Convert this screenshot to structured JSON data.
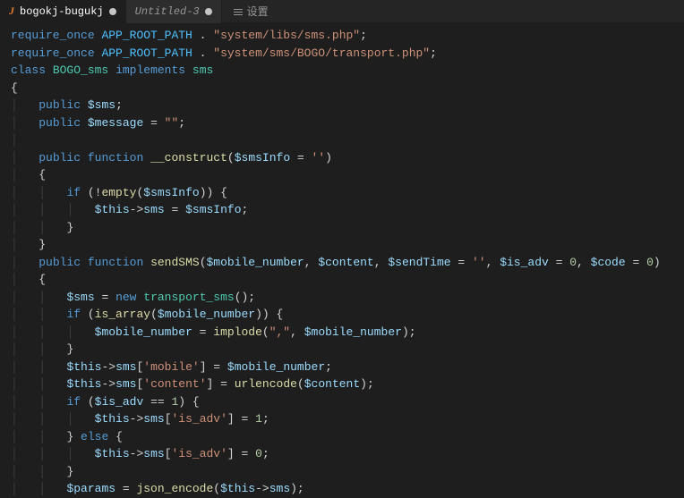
{
  "tabs": [
    {
      "icon": "J",
      "label": "bogokj-bugukj",
      "modified": true
    },
    {
      "label": "Untitled-3",
      "modified": true
    }
  ],
  "menu": {
    "settings_label": "设置"
  },
  "code": {
    "lines": [
      [
        [
          "kw",
          "require_once"
        ],
        [
          "punc",
          " "
        ],
        [
          "const",
          "APP_ROOT_PATH"
        ],
        [
          "punc",
          " . "
        ],
        [
          "str",
          "\"system/libs/sms.php\""
        ],
        [
          "punc",
          ";"
        ]
      ],
      [
        [
          "kw",
          "require_once"
        ],
        [
          "punc",
          " "
        ],
        [
          "const",
          "APP_ROOT_PATH"
        ],
        [
          "punc",
          " . "
        ],
        [
          "str",
          "\"system/sms/BOGO/transport.php\""
        ],
        [
          "punc",
          ";"
        ]
      ],
      [
        [
          "kw",
          "class"
        ],
        [
          "punc",
          " "
        ],
        [
          "cls",
          "BOGO_sms"
        ],
        [
          "punc",
          " "
        ],
        [
          "kw",
          "implements"
        ],
        [
          "punc",
          " "
        ],
        [
          "cls",
          "sms"
        ]
      ],
      [
        [
          "brace",
          "{"
        ]
      ],
      [
        [
          "pad",
          "  "
        ],
        [
          "kw",
          "public"
        ],
        [
          "punc",
          " "
        ],
        [
          "var",
          "$sms"
        ],
        [
          "punc",
          ";"
        ]
      ],
      [
        [
          "pad",
          "  "
        ],
        [
          "kw",
          "public"
        ],
        [
          "punc",
          " "
        ],
        [
          "var",
          "$message"
        ],
        [
          "punc",
          " = "
        ],
        [
          "str",
          "\"\""
        ],
        [
          "punc",
          ";"
        ]
      ],
      [
        [
          "pad",
          " "
        ]
      ],
      [
        [
          "pad",
          "  "
        ],
        [
          "kw",
          "public"
        ],
        [
          "punc",
          " "
        ],
        [
          "kw",
          "function"
        ],
        [
          "punc",
          " "
        ],
        [
          "fn",
          "__construct"
        ],
        [
          "punc",
          "("
        ],
        [
          "var",
          "$smsInfo"
        ],
        [
          "punc",
          " = "
        ],
        [
          "str",
          "''"
        ],
        [
          "punc",
          ")"
        ]
      ],
      [
        [
          "pad",
          "  "
        ],
        [
          "brace",
          "{"
        ]
      ],
      [
        [
          "pad",
          "    "
        ],
        [
          "kw",
          "if"
        ],
        [
          "punc",
          " (!"
        ],
        [
          "fn",
          "empty"
        ],
        [
          "punc",
          "("
        ],
        [
          "var",
          "$smsInfo"
        ],
        [
          "punc",
          ")) {"
        ]
      ],
      [
        [
          "pad",
          "      "
        ],
        [
          "var",
          "$this"
        ],
        [
          "punc",
          "->"
        ],
        [
          "var",
          "sms"
        ],
        [
          "punc",
          " = "
        ],
        [
          "var",
          "$smsInfo"
        ],
        [
          "punc",
          ";"
        ]
      ],
      [
        [
          "pad",
          "    "
        ],
        [
          "brace",
          "}"
        ]
      ],
      [
        [
          "pad",
          "  "
        ],
        [
          "brace",
          "}"
        ]
      ],
      [
        [
          "pad",
          "  "
        ],
        [
          "kw",
          "public"
        ],
        [
          "punc",
          " "
        ],
        [
          "kw",
          "function"
        ],
        [
          "punc",
          " "
        ],
        [
          "fn",
          "sendSMS"
        ],
        [
          "punc",
          "("
        ],
        [
          "var",
          "$mobile_number"
        ],
        [
          "punc",
          ", "
        ],
        [
          "var",
          "$content"
        ],
        [
          "punc",
          ", "
        ],
        [
          "var",
          "$sendTime"
        ],
        [
          "punc",
          " = "
        ],
        [
          "str",
          "''"
        ],
        [
          "punc",
          ", "
        ],
        [
          "var",
          "$is_adv"
        ],
        [
          "punc",
          " = "
        ],
        [
          "num",
          "0"
        ],
        [
          "punc",
          ", "
        ],
        [
          "var",
          "$code"
        ],
        [
          "punc",
          " = "
        ],
        [
          "num",
          "0"
        ],
        [
          "punc",
          ")"
        ]
      ],
      [
        [
          "pad",
          "  "
        ],
        [
          "brace",
          "{"
        ]
      ],
      [
        [
          "pad",
          "    "
        ],
        [
          "var",
          "$sms"
        ],
        [
          "punc",
          " = "
        ],
        [
          "kw",
          "new"
        ],
        [
          "punc",
          " "
        ],
        [
          "cls",
          "transport_sms"
        ],
        [
          "punc",
          "();"
        ]
      ],
      [
        [
          "pad",
          "    "
        ],
        [
          "kw",
          "if"
        ],
        [
          "punc",
          " ("
        ],
        [
          "fn",
          "is_array"
        ],
        [
          "punc",
          "("
        ],
        [
          "var",
          "$mobile_number"
        ],
        [
          "punc",
          ")) {"
        ]
      ],
      [
        [
          "pad",
          "      "
        ],
        [
          "var",
          "$mobile_number"
        ],
        [
          "punc",
          " = "
        ],
        [
          "fn",
          "implode"
        ],
        [
          "punc",
          "("
        ],
        [
          "str",
          "\",\""
        ],
        [
          "punc",
          ", "
        ],
        [
          "var",
          "$mobile_number"
        ],
        [
          "punc",
          ");"
        ]
      ],
      [
        [
          "pad",
          "    "
        ],
        [
          "brace",
          "}"
        ]
      ],
      [
        [
          "pad",
          "    "
        ],
        [
          "var",
          "$this"
        ],
        [
          "punc",
          "->"
        ],
        [
          "var",
          "sms"
        ],
        [
          "punc",
          "["
        ],
        [
          "str",
          "'mobile'"
        ],
        [
          "punc",
          "] = "
        ],
        [
          "var",
          "$mobile_number"
        ],
        [
          "punc",
          ";"
        ]
      ],
      [
        [
          "pad",
          "    "
        ],
        [
          "var",
          "$this"
        ],
        [
          "punc",
          "->"
        ],
        [
          "var",
          "sms"
        ],
        [
          "punc",
          "["
        ],
        [
          "str",
          "'content'"
        ],
        [
          "punc",
          "] = "
        ],
        [
          "fn",
          "urlencode"
        ],
        [
          "punc",
          "("
        ],
        [
          "var",
          "$content"
        ],
        [
          "punc",
          ");"
        ]
      ],
      [
        [
          "pad",
          "    "
        ],
        [
          "kw",
          "if"
        ],
        [
          "punc",
          " ("
        ],
        [
          "var",
          "$is_adv"
        ],
        [
          "punc",
          " == "
        ],
        [
          "num",
          "1"
        ],
        [
          "punc",
          ") {"
        ]
      ],
      [
        [
          "pad",
          "      "
        ],
        [
          "var",
          "$this"
        ],
        [
          "punc",
          "->"
        ],
        [
          "var",
          "sms"
        ],
        [
          "punc",
          "["
        ],
        [
          "str",
          "'is_adv'"
        ],
        [
          "punc",
          "] = "
        ],
        [
          "num",
          "1"
        ],
        [
          "punc",
          ";"
        ]
      ],
      [
        [
          "pad",
          "    "
        ],
        [
          "punc",
          "} "
        ],
        [
          "kw",
          "else"
        ],
        [
          "punc",
          " {"
        ]
      ],
      [
        [
          "pad",
          "      "
        ],
        [
          "var",
          "$this"
        ],
        [
          "punc",
          "->"
        ],
        [
          "var",
          "sms"
        ],
        [
          "punc",
          "["
        ],
        [
          "str",
          "'is_adv'"
        ],
        [
          "punc",
          "] = "
        ],
        [
          "num",
          "0"
        ],
        [
          "punc",
          ";"
        ]
      ],
      [
        [
          "pad",
          "    "
        ],
        [
          "brace",
          "}"
        ]
      ],
      [
        [
          "pad",
          "    "
        ],
        [
          "var",
          "$params"
        ],
        [
          "punc",
          " = "
        ],
        [
          "fn",
          "json_encode"
        ],
        [
          "punc",
          "("
        ],
        [
          "var",
          "$this"
        ],
        [
          "punc",
          "->"
        ],
        [
          "var",
          "sms"
        ],
        [
          "punc",
          ");"
        ]
      ]
    ]
  }
}
